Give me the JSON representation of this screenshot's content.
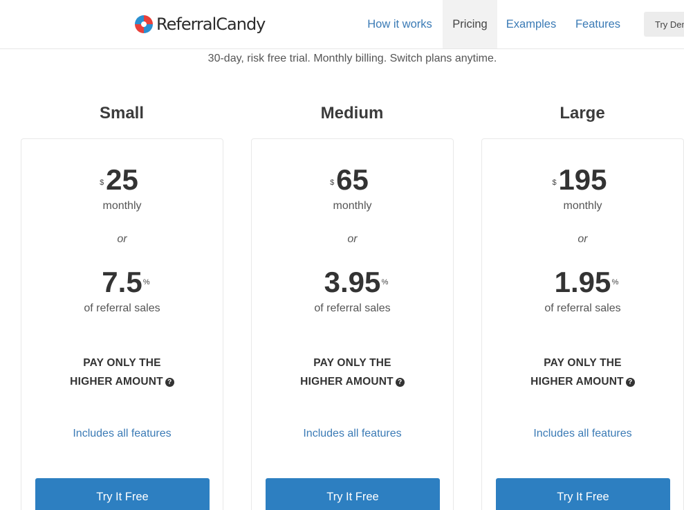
{
  "header": {
    "logo_text_part1": "Referral",
    "logo_text_part2": "Candy",
    "nav": [
      {
        "label": "How it works",
        "active": false
      },
      {
        "label": "Pricing",
        "active": true
      },
      {
        "label": "Examples",
        "active": false
      },
      {
        "label": "Features",
        "active": false
      }
    ],
    "try_demo_label": "Try Demo"
  },
  "subtitle": "30-day, risk free trial. Monthly billing. Switch plans anytime.",
  "plans": [
    {
      "name": "Small",
      "currency": "$",
      "price": "25",
      "period": "monthly",
      "or": "or",
      "percent": "7.5",
      "percent_sign": "%",
      "percent_label": "of referral sales",
      "pay_line1": "PAY ONLY THE",
      "pay_line2": "HIGHER AMOUNT",
      "help_icon": "?",
      "features": "Includes all features",
      "cta": "Try It Free"
    },
    {
      "name": "Medium",
      "currency": "$",
      "price": "65",
      "period": "monthly",
      "or": "or",
      "percent": "3.95",
      "percent_sign": "%",
      "percent_label": "of referral sales",
      "pay_line1": "PAY ONLY THE",
      "pay_line2": "HIGHER AMOUNT",
      "help_icon": "?",
      "features": "Includes all features",
      "cta": "Try It Free"
    },
    {
      "name": "Large",
      "currency": "$",
      "price": "195",
      "period": "monthly",
      "or": "or",
      "percent": "1.95",
      "percent_sign": "%",
      "percent_label": "of referral sales",
      "pay_line1": "PAY ONLY THE",
      "pay_line2": "HIGHER AMOUNT",
      "help_icon": "?",
      "features": "Includes all features",
      "cta": "Try It Free"
    }
  ],
  "colors": {
    "link": "#3a7ab5",
    "button": "#2d7fc1",
    "logo_red": "#e8403a",
    "logo_blue": "#2a8fd0"
  }
}
